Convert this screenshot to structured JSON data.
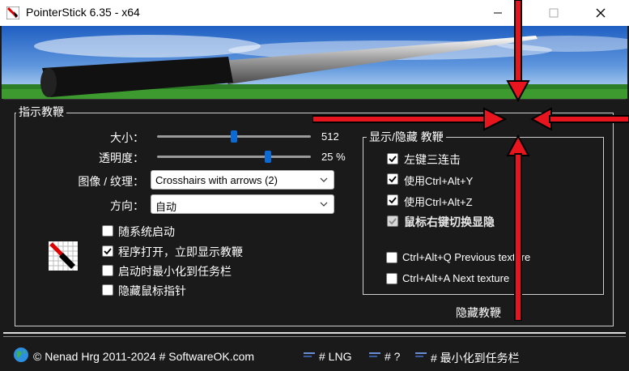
{
  "window": {
    "title": "PointerStick 6.35 - x64"
  },
  "group_main": {
    "title": "指示教鞭",
    "size_label": "大小：",
    "size_value": "512",
    "size_level": 0.5,
    "opacity_label": "透明度：",
    "opacity_value": "25 %",
    "opacity_level": 0.73,
    "texture_label": "图像 / 纹理：",
    "texture_value": "Crosshairs with arrows (2)",
    "direction_label": "方向：",
    "direction_value": "自动",
    "options": [
      {
        "label": "随系统启动",
        "checked": false
      },
      {
        "label": "程序打开，立即显示教鞭",
        "checked": true
      },
      {
        "label": "启动时最小化到任务栏",
        "checked": false
      },
      {
        "label": "隐藏鼠标指针",
        "checked": false
      }
    ]
  },
  "group_show": {
    "title": "显示/隐藏 教鞭",
    "options": [
      {
        "label": "左键三连击",
        "checked": true
      },
      {
        "label": "使用Ctrl+Alt+Y",
        "checked": true
      },
      {
        "label": "使用Ctrl+Alt+Z",
        "checked": true
      },
      {
        "label": "鼠标右键切换显隐",
        "checked": true,
        "disabled": true
      },
      {
        "label": "Ctrl+Alt+Q Previous texture",
        "checked": false
      },
      {
        "label": "Ctrl+Alt+A Next texture",
        "checked": false
      }
    ]
  },
  "hide_link": "隐藏教鞭",
  "status": {
    "copyright": "© Nenad Hrg 2011-2024 # SoftwareOK.com",
    "lng": "# LNG",
    "help": "# ?",
    "minimize": "# 最小化到任务栏"
  },
  "colors": {
    "accent": "#0a6ad6",
    "arrow": "#e8141e",
    "background": "#1a1a1a"
  }
}
